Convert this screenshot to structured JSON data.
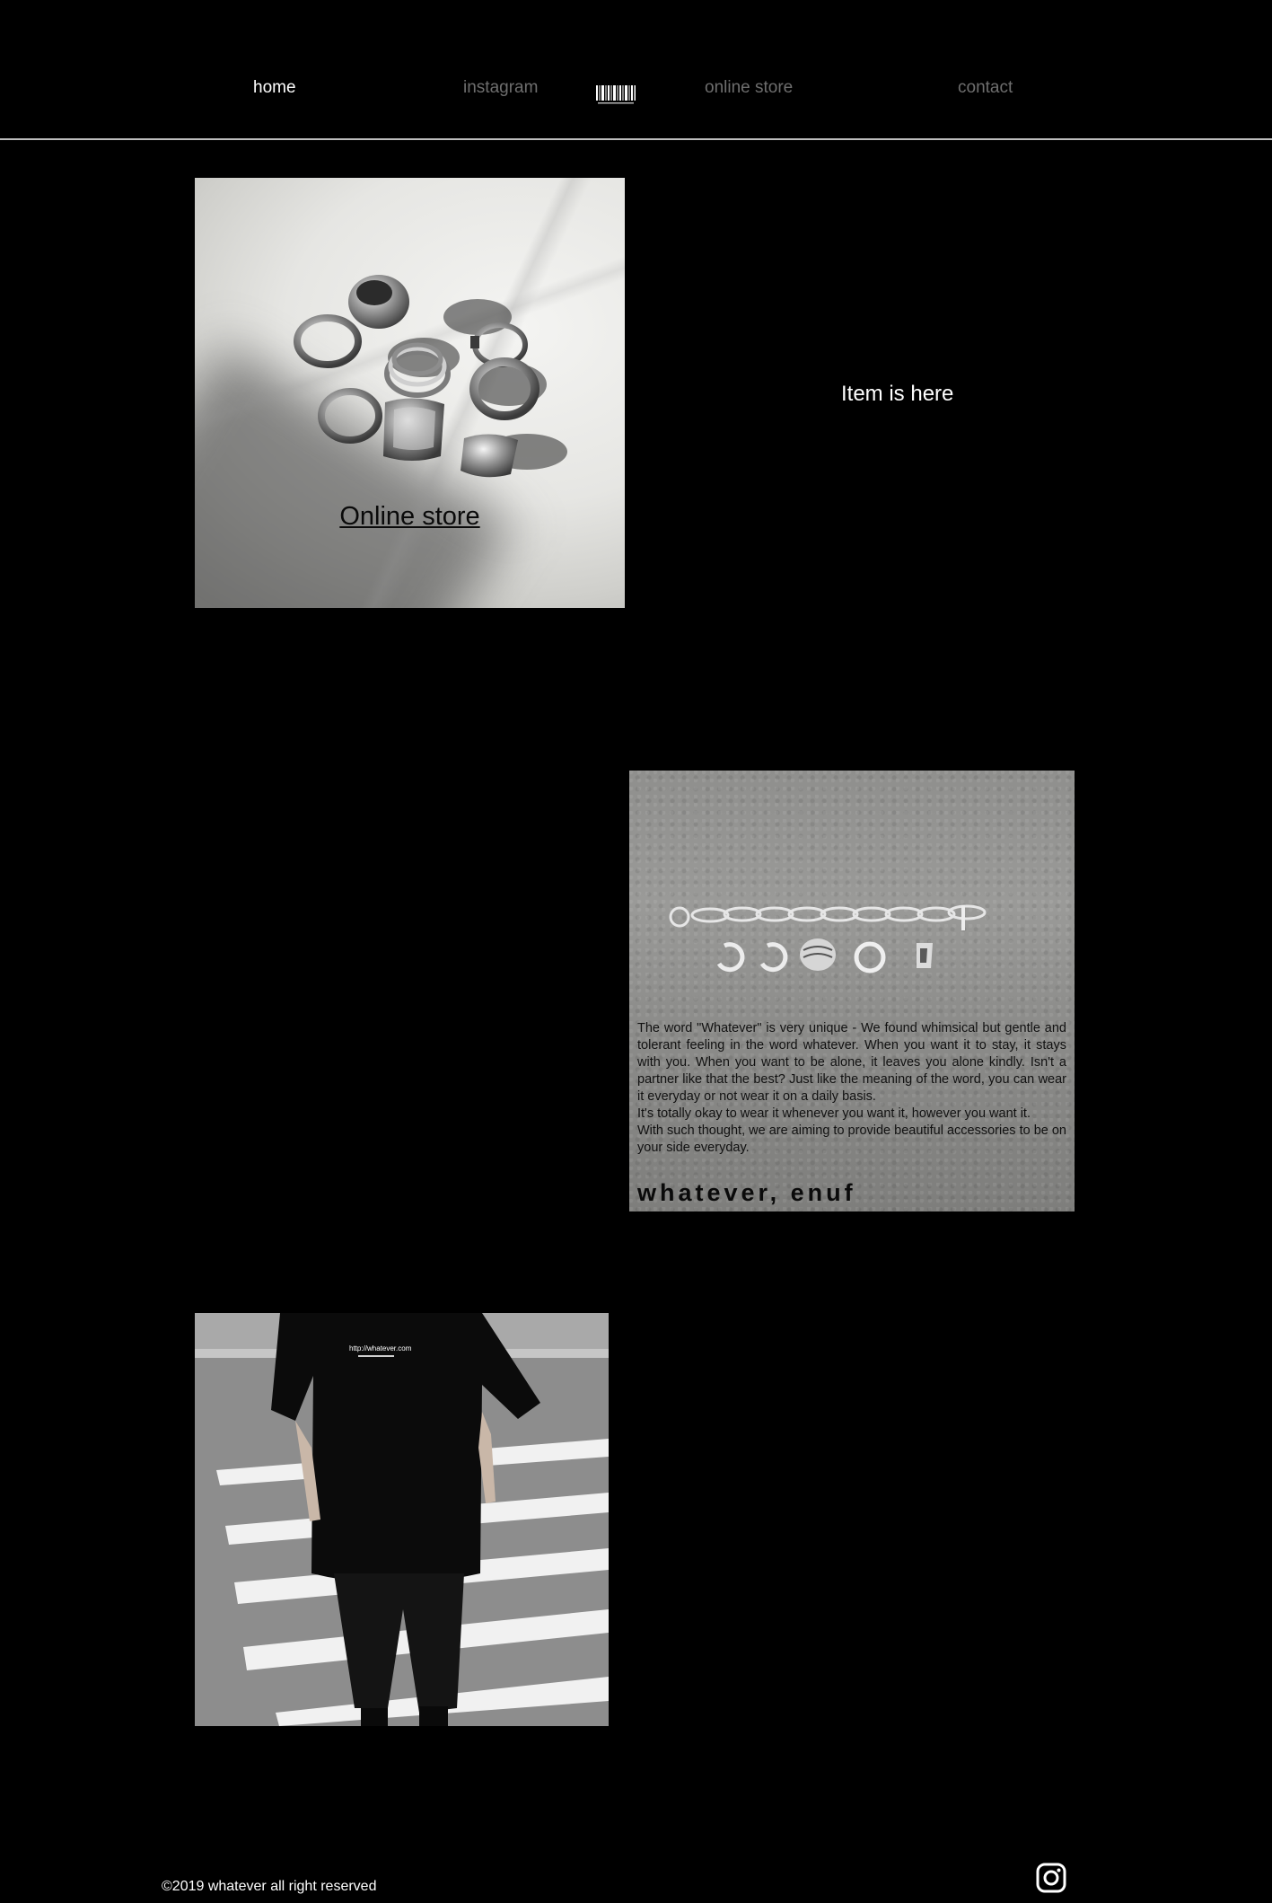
{
  "header": {
    "nav": [
      {
        "label": "home",
        "active": true
      },
      {
        "label": "instagram",
        "active": false
      },
      {
        "label": "online store",
        "active": false
      },
      {
        "label": "contact",
        "active": false
      }
    ],
    "logo_icon": "barcode-logo"
  },
  "sections": {
    "rings_tile": {
      "link_label": "Online store"
    },
    "item_label": "Item is here",
    "concrete_tile": {
      "paragraph_1": "The word \"Whatever\" is very unique - We found whimsical but gentle and tolerant feeling in the word whatever. When you want it to stay, it stays with you. When you want to be alone, it leaves you alone kindly. Isn't a partner like that the best? Just like the meaning of the word, you can wear it everyday or not wear it on a daily basis.",
      "paragraph_2": "It's totally okay to wear it whenever you want it, however you want it.",
      "paragraph_3": "With such thought, we are aiming to provide beautiful accessories to be on your side everyday.",
      "brand": "whatever, enuf"
    },
    "street_tile": {
      "shirt_text": "http://whatever.com"
    }
  },
  "footer": {
    "copyright": "©2019 whatever all right reserved",
    "social_icon": "instagram-icon"
  },
  "colors": {
    "background": "#000000",
    "nav_active": "#ffffff",
    "nav_inactive": "#6e6e6e",
    "divider": "#bdbdbd"
  }
}
